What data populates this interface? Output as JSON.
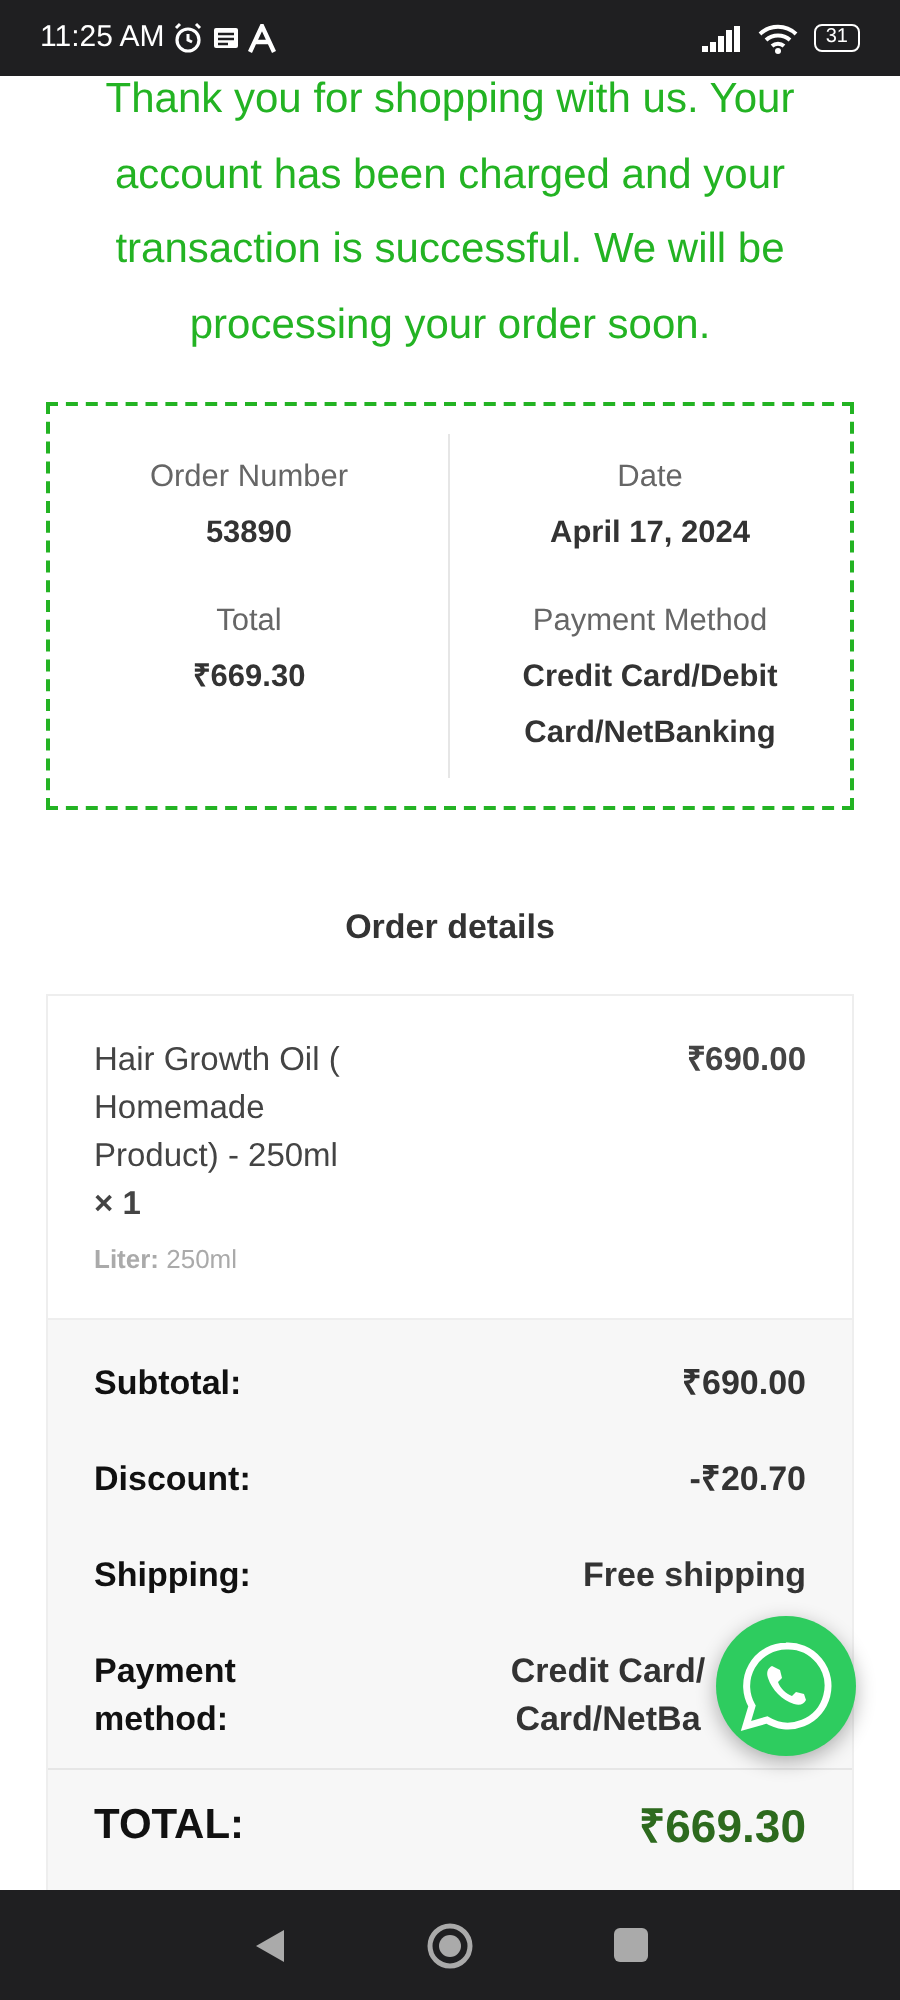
{
  "status_bar": {
    "time": "11:25 AM",
    "battery": "31"
  },
  "message": "Thank you for shopping with us. Your account has been charged and your transaction is successful. We will be processing your order soon.",
  "summary": [
    {
      "label": "Order Number",
      "value": "53890"
    },
    {
      "label": "Date",
      "value": "April 17, 2024"
    },
    {
      "label": "Total",
      "value": "₹669.30"
    },
    {
      "label": "Payment Method",
      "value": "Credit Card/Debit Card/NetBanking"
    }
  ],
  "order_details": {
    "title": "Order details",
    "items": [
      {
        "name": "Hair Growth Oil ( Homemade Product) - 250ml",
        "quantity": "× 1",
        "price": "₹690.00",
        "meta_label": "Liter:",
        "meta_value": "250ml"
      }
    ],
    "totals": [
      {
        "kind": "row",
        "label": "Subtotal:",
        "value": "₹690.00"
      },
      {
        "kind": "row",
        "label": "Discount:",
        "value": "-₹20.70"
      },
      {
        "kind": "row",
        "label": "Shipping:",
        "value": "Free shipping"
      },
      {
        "kind": "covered",
        "label": "Payment method:",
        "value": "Credit Card/ Card/NetBa"
      },
      {
        "kind": "grand",
        "label": "TOTAL:",
        "value": "₹669.30"
      }
    ]
  }
}
